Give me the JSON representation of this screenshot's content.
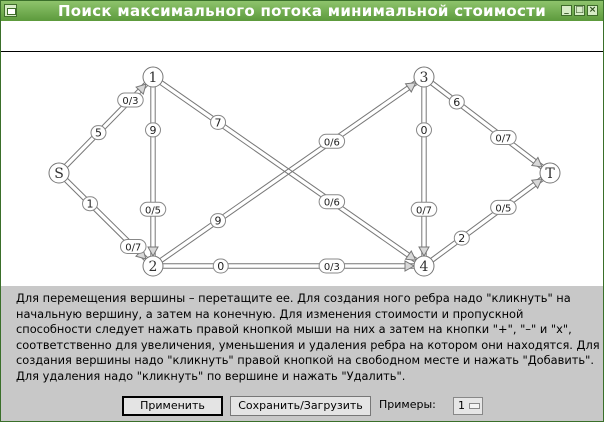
{
  "window": {
    "title": "Поиск максимального потока минимальной стоимости"
  },
  "graph": {
    "nodes": [
      {
        "id": "S",
        "label": "S"
      },
      {
        "id": "1",
        "label": "1"
      },
      {
        "id": "2",
        "label": "2"
      },
      {
        "id": "3",
        "label": "3"
      },
      {
        "id": "4",
        "label": "4"
      },
      {
        "id": "T",
        "label": "T"
      }
    ],
    "edges": [
      {
        "from": "S",
        "to": "1",
        "cost": "5",
        "flow": "0/3"
      },
      {
        "from": "S",
        "to": "2",
        "cost": "1",
        "flow": "0/7"
      },
      {
        "from": "1",
        "to": "2",
        "cost": "9",
        "flow": "0/5"
      },
      {
        "from": "1",
        "to": "4",
        "cost": "7",
        "flow": "0/6"
      },
      {
        "from": "2",
        "to": "3",
        "cost": "9",
        "flow": "0/6"
      },
      {
        "from": "2",
        "to": "4",
        "cost": "0",
        "flow": "0/3"
      },
      {
        "from": "3",
        "to": "4",
        "cost": "0",
        "flow": "0/7"
      },
      {
        "from": "3",
        "to": "T",
        "cost": "6",
        "flow": "0/7"
      },
      {
        "from": "4",
        "to": "T",
        "cost": "2",
        "flow": "0/5"
      }
    ]
  },
  "instructions": {
    "text": "Для перемещения вершины – перетащите ее. Для создания ного ребра надо \"кликнуть\" на начальную вершину, а затем на конечную. Для изменения стоимости и пропускной способности следует нажать правой кнопкой мыши на них а затем на кнопки \"+\", \"–\" и \"x\", соответственно для увеличения, уменьшения и удаления ребра на котором они находятся. Для создания вершины надо \"кликнуть\" правой кнопкой на свободном месте и нажать \"Добавить\". Для удаления надо \"кликнуть\" по вершине и нажать \"Удалить\"."
  },
  "controls": {
    "apply_label": "Применить",
    "save_load_label": "Сохранить/Загрузить",
    "examples_label": "Примеры:",
    "examples_selected": "1"
  }
}
